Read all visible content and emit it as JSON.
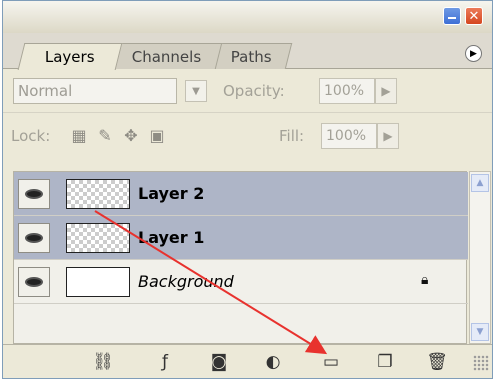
{
  "window": {
    "minimize_icon": "minimize-icon",
    "close_icon": "close-icon",
    "close_glyph": "✕"
  },
  "tabs": [
    {
      "label": "Layers",
      "active": true
    },
    {
      "label": "Channels",
      "active": false
    },
    {
      "label": "Paths",
      "active": false
    }
  ],
  "options": {
    "blend_mode": "Normal",
    "opacity_label": "Opacity:",
    "opacity_value": "100%",
    "lock_label": "Lock:",
    "fill_label": "Fill:",
    "fill_value": "100%"
  },
  "layers": [
    {
      "name": "Layer 2",
      "selected": true,
      "thumb": "transparent",
      "visible": true
    },
    {
      "name": "Layer 1",
      "selected": true,
      "thumb": "transparent",
      "visible": true
    },
    {
      "name": "Background",
      "selected": false,
      "thumb": "white",
      "visible": true,
      "locked": true
    }
  ],
  "colors": {
    "panel_bg": "#ece9d8",
    "selection": "#aeb5c7",
    "annotation_arrow": "#e8322e"
  },
  "bottom_icons": [
    "link-layers-icon",
    "layer-style-icon",
    "layer-mask-icon",
    "adjustment-layer-icon",
    "new-group-icon",
    "new-layer-icon",
    "delete-layer-icon"
  ]
}
